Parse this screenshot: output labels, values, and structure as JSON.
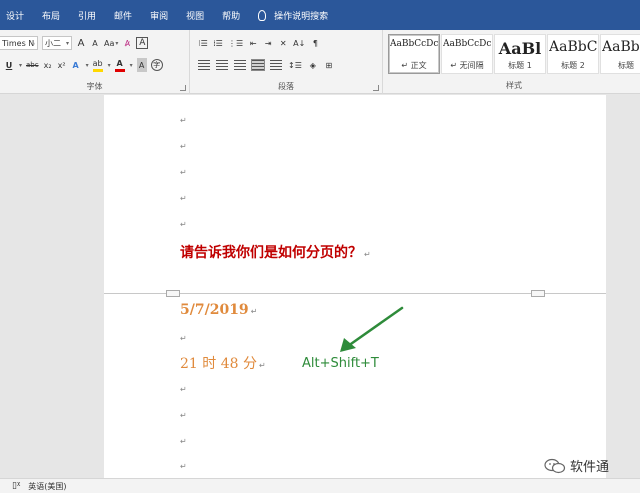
{
  "tabs": [
    "设计",
    "布局",
    "引用",
    "邮件",
    "审阅",
    "视图",
    "帮助"
  ],
  "search_tab": "操作说明搜索",
  "ribbon": {
    "font_group_label": "字体",
    "paragraph_group_label": "段落",
    "styles_group_label": "样式",
    "font_name": "Times New R",
    "font_size": "小二",
    "grow_font": "A",
    "shrink_font": "A",
    "change_case": "Aa",
    "char_border": "A",
    "underline": "U",
    "strikethrough": "abc",
    "subscript": "x₂",
    "superscript": "x²",
    "text_effects": "A",
    "font_color": "A",
    "char_shading": "A",
    "enclose_char": "字",
    "styles": [
      {
        "sample": "AaBbCcDc",
        "name": "↵ 正文",
        "active": true
      },
      {
        "sample": "AaBbCcDc",
        "name": "↵ 无间隔",
        "active": false
      },
      {
        "sample": "AaBl",
        "name": "标题 1",
        "active": false
      },
      {
        "sample": "AaBbC",
        "name": "标题 2",
        "active": false
      },
      {
        "sample": "AaBbC",
        "name": "标题",
        "active": false
      }
    ]
  },
  "document": {
    "question": "请告诉我你们是如何分页的？",
    "date": "5/7/2019",
    "time": "21 时 48 分",
    "shortcut": "Alt+Shift+T",
    "paragraph_mark": "↵"
  },
  "status": {
    "language": "英语(美国)"
  },
  "watermark": "软件通",
  "colors": {
    "ribbon_blue": "#2b579a",
    "question_red": "#c00000",
    "date_orange": "#e08a3c",
    "arrow_green": "#2e8b3a"
  }
}
